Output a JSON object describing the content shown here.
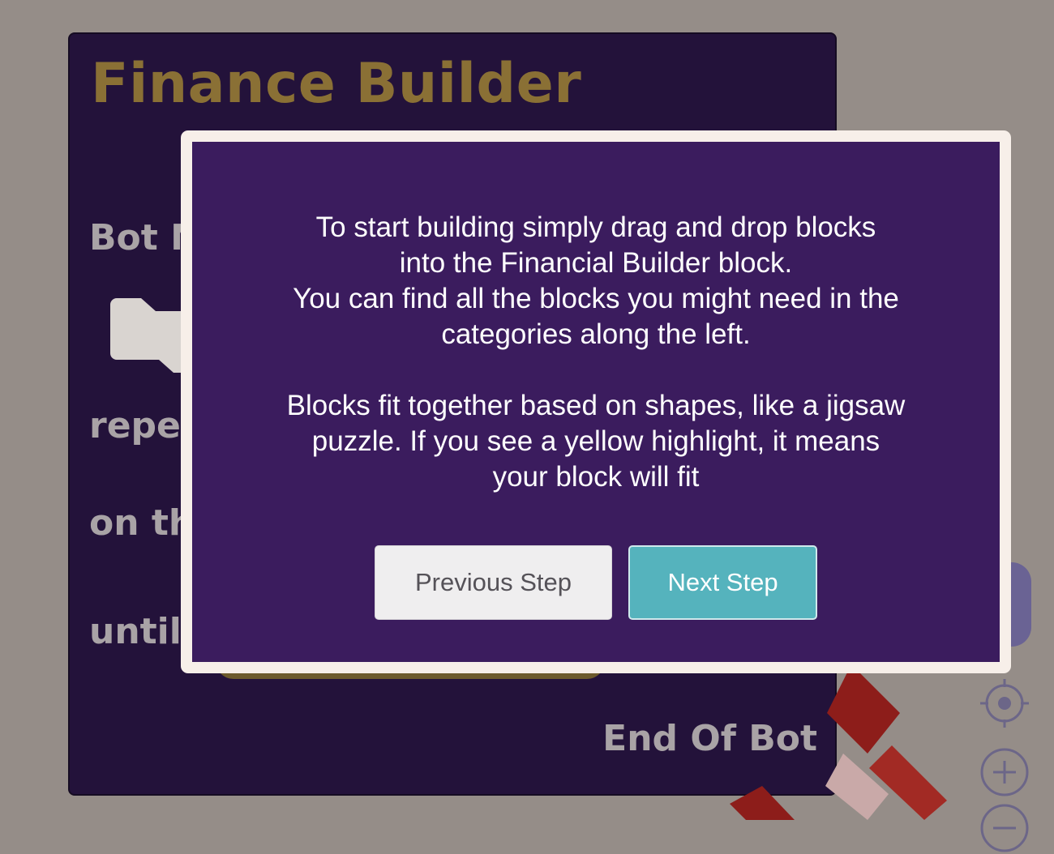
{
  "workspace": {
    "builder_title": "Finance Builder",
    "label_bot_name": "Bot N",
    "label_repeat": "repea",
    "label_on_the": "on th",
    "label_until": "until",
    "label_end": "End Of Bot"
  },
  "modal": {
    "paragraph_1_line_1": "To start building simply drag and drop blocks",
    "paragraph_1_line_2": "into the Financial Builder block.",
    "paragraph_1_line_3": "You can find all the blocks you might need in the",
    "paragraph_1_line_4": "categories along the left.",
    "paragraph_2_line_1": "Blocks fit together based on shapes, like a jigsaw",
    "paragraph_2_line_2": "puzzle. If you see a yellow highlight, it means",
    "paragraph_2_line_3": "your block will fit",
    "previous_button": "Previous Step",
    "next_button": "Next Step"
  },
  "controls": {
    "recenter_icon": "crosshair-icon",
    "zoom_in_icon": "zoom-in-icon",
    "zoom_out_icon": "zoom-out-icon"
  },
  "colors": {
    "background": "#958d88",
    "builder_block": "#23123a",
    "builder_title": "#8a7035",
    "modal_frame": "#f7efe9",
    "modal_body": "#3b1c5e",
    "next_button": "#55b3bd",
    "previous_button": "#efeeef"
  }
}
